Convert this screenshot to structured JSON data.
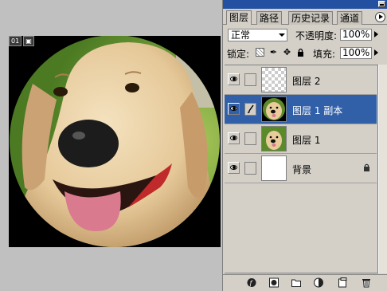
{
  "document": {
    "tag_number": "01"
  },
  "panel": {
    "tabs": [
      {
        "label": "图层",
        "active": true
      },
      {
        "label": "路径",
        "active": false
      },
      {
        "label": "历史记录",
        "active": false
      },
      {
        "label": "通道",
        "active": false
      }
    ],
    "blend_mode": "正常",
    "opacity_label": "不透明度:",
    "opacity_value": "100%",
    "lock_label": "锁定:",
    "fill_label": "填充:",
    "fill_value": "100%",
    "layers": [
      {
        "name": "图层 2",
        "visible": true,
        "selected": false,
        "thumb": "transparent"
      },
      {
        "name": "图层 1 副本",
        "visible": true,
        "selected": true,
        "thumb": "dog-circle"
      },
      {
        "name": "图层 1",
        "visible": true,
        "selected": false,
        "thumb": "dog"
      },
      {
        "name": "背景",
        "visible": true,
        "selected": false,
        "thumb": "white",
        "locked": true
      }
    ],
    "bottom_icons": [
      "layer-style-icon",
      "mask-icon",
      "new-group-icon",
      "adjustment-layer-icon",
      "new-layer-icon",
      "delete-layer-icon"
    ]
  },
  "colors": {
    "selection": "#3260a8",
    "title_bar": "#2350a0",
    "panel_bg": "#d4d0c8"
  }
}
